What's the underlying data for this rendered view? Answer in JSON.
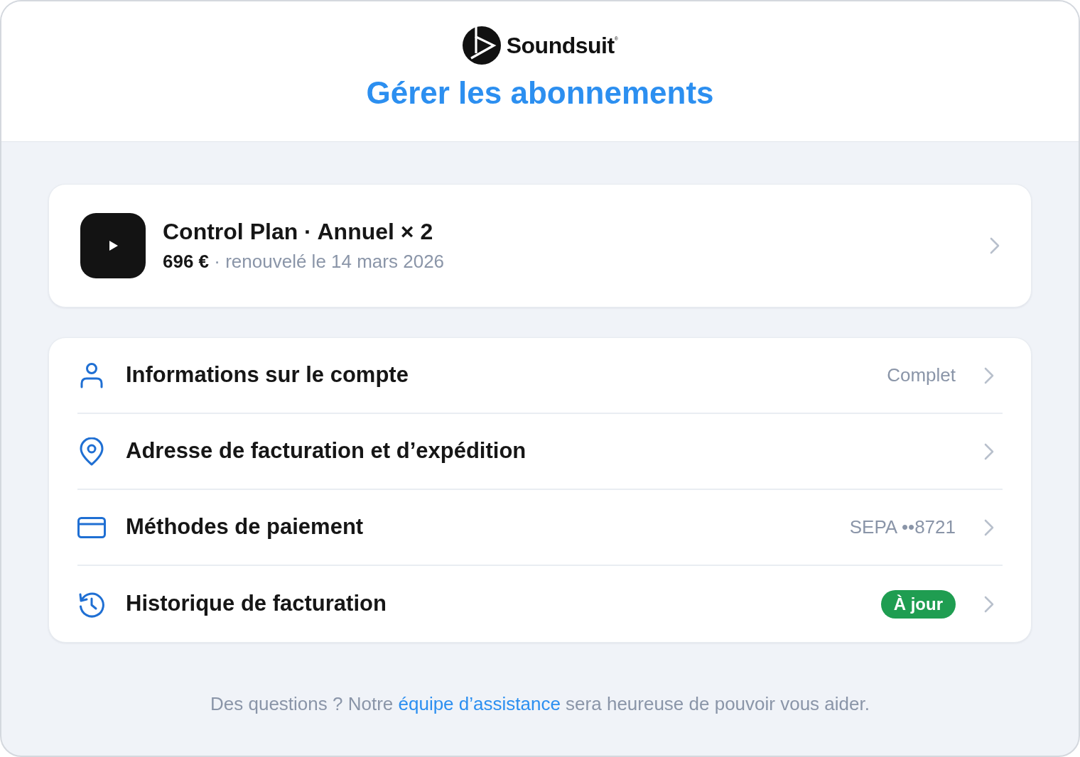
{
  "brand": {
    "name": "Soundsuit$^{®}$"
  },
  "title": "Gérer les abonnements",
  "plan": {
    "name": "Control Plan · Annuel × 2",
    "price": "696 €",
    "renewal": "· renouvelé le 14 mars 2026"
  },
  "menu": [
    {
      "kind": "account",
      "label": "Informations sur le compte",
      "value": "Complet"
    },
    {
      "kind": "address",
      "label": "Adresse de facturation et d’expédition"
    },
    {
      "kind": "payment",
      "label": "Méthodes de paiement",
      "value": "SEPA ••8721"
    },
    {
      "kind": "history",
      "label": "Historique de facturation",
      "badge": "À jour"
    }
  ],
  "footer": {
    "before": "Des questions ? Notre",
    "link": "équipe d’assistance",
    "after": "sera heureuse de pouvoir vous aider."
  }
}
